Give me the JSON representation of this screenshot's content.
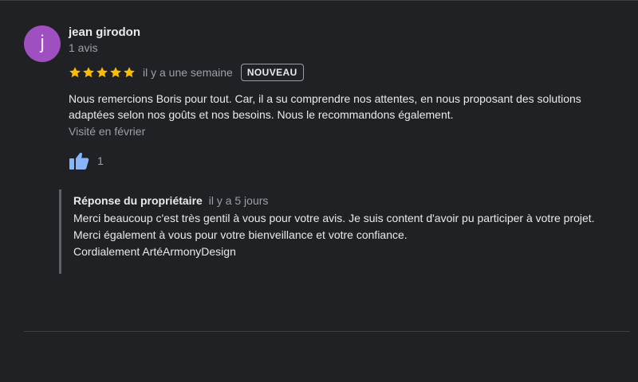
{
  "review": {
    "author": {
      "initial": "j",
      "name": "jean girodon",
      "meta": "1 avis",
      "avatar_color": "#a04fc0"
    },
    "rating": {
      "stars": 5,
      "max": 5,
      "star_color": "#fbbc04",
      "relative_date": "il y a une semaine",
      "badge": "NOUVEAU"
    },
    "text": "Nous remercions Boris pour tout. Car, il a su comprendre nos attentes, en nous proposant des solutions adaptées selon nos goûts et nos besoins. Nous le recommandons également.",
    "visited": "Visité en février",
    "likes": {
      "icon": "thumbs-up-icon",
      "count": "1",
      "icon_color": "#8ab4f8"
    }
  },
  "owner_reply": {
    "title": "Réponse du propriétaire",
    "date": "il y a 5 jours",
    "lines": [
      "Merci beaucoup c'est très gentil à vous pour votre avis. Je suis content d'avoir pu participer à votre projet.",
      "Merci également à vous pour votre bienveillance et votre confiance.",
      "Cordialement ArtéArmonyDesign"
    ]
  },
  "theme": {
    "background": "#202124",
    "text": "#e8eaed",
    "muted_text": "#9aa0a6",
    "divider": "#3c4043"
  }
}
